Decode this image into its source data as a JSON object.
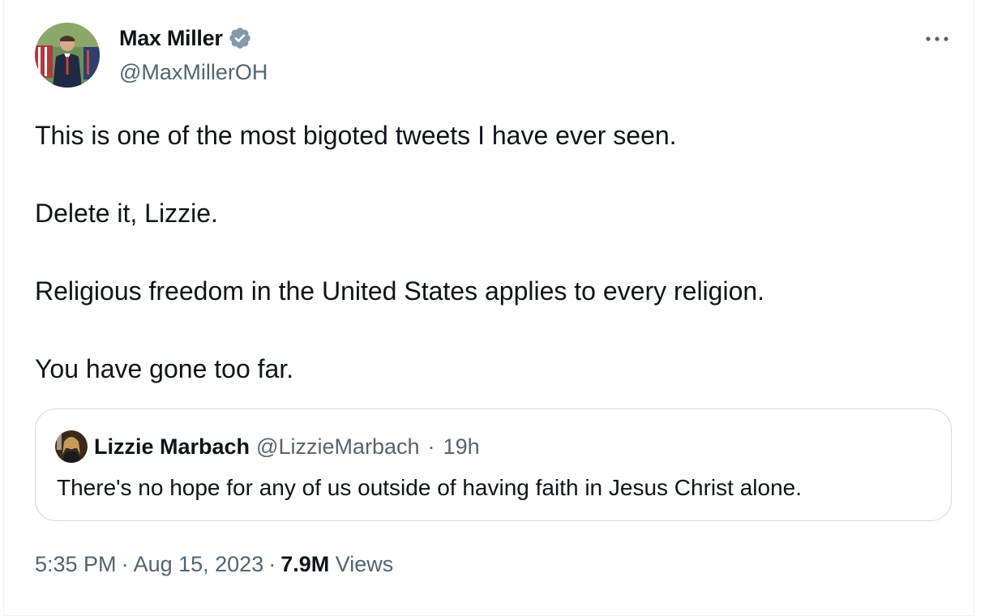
{
  "tweet": {
    "author_name": "Max Miller",
    "author_handle": "@MaxMillerOH",
    "verified": true,
    "paragraphs": [
      "This is one of the most bigoted tweets I have ever seen.",
      "Delete it, Lizzie.",
      "Religious freedom in the United States applies to every religion.",
      "You have gone too far."
    ],
    "time": "5:35 PM",
    "date": "Aug 15, 2023",
    "separator": "·",
    "views_count": "7.9M",
    "views_label": "Views"
  },
  "quote": {
    "author_name": "Lizzie Marbach",
    "author_handle": "@LizzieMarbach",
    "separator": "·",
    "time_ago": "19h",
    "text": "There's no hope for any of us outside of having faith in Jesus Christ alone."
  },
  "icons": {
    "verified": "verified-badge-icon",
    "more": "more-options-icon"
  },
  "colors": {
    "text_primary": "#0f1419",
    "text_secondary": "#536471",
    "verified_badge": "#829aab",
    "border": "#cfd9de"
  }
}
